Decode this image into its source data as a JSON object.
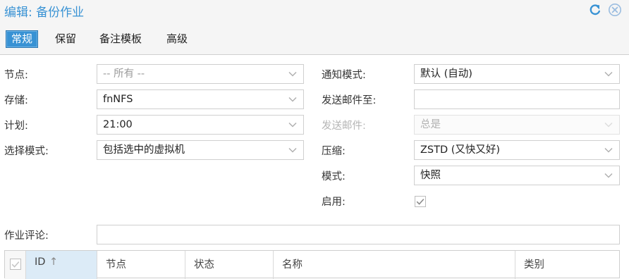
{
  "window": {
    "title": "编辑: 备份作业",
    "reset_icon": "reset-icon",
    "close_icon": "close-icon"
  },
  "tabs": [
    {
      "label": "常规",
      "active": true
    },
    {
      "label": "保留",
      "active": false
    },
    {
      "label": "备注模板",
      "active": false
    },
    {
      "label": "高级",
      "active": false
    }
  ],
  "form_left": {
    "node": {
      "label": "节点:",
      "value": "-- 所有 --"
    },
    "storage": {
      "label": "存储:",
      "value": "fnNFS"
    },
    "schedule": {
      "label": "计划:",
      "value": "21:00"
    },
    "selection_mode": {
      "label": "选择模式:",
      "value": "包括选中的虚拟机"
    }
  },
  "form_right": {
    "notification_mode": {
      "label": "通知模式:",
      "value": "默认 (自动)"
    },
    "send_email_to": {
      "label": "发送邮件至:",
      "value": ""
    },
    "send_email": {
      "label": "发送邮件:",
      "value": "总是"
    },
    "compression": {
      "label": "压缩:",
      "value": "ZSTD (又快又好)"
    },
    "mode": {
      "label": "模式:",
      "value": "快照"
    },
    "enabled": {
      "label": "启用:",
      "checked": true
    }
  },
  "comment": {
    "label": "作业评论:",
    "value": ""
  },
  "grid": {
    "columns": [
      "ID",
      "节点",
      "状态",
      "名称",
      "类别"
    ],
    "sort_indicator": "↑",
    "header_checkbox_checked": false
  },
  "colors": {
    "accent": "#3892d4",
    "border": "#cfcfcf",
    "header_bg": "#f5f5f5"
  }
}
